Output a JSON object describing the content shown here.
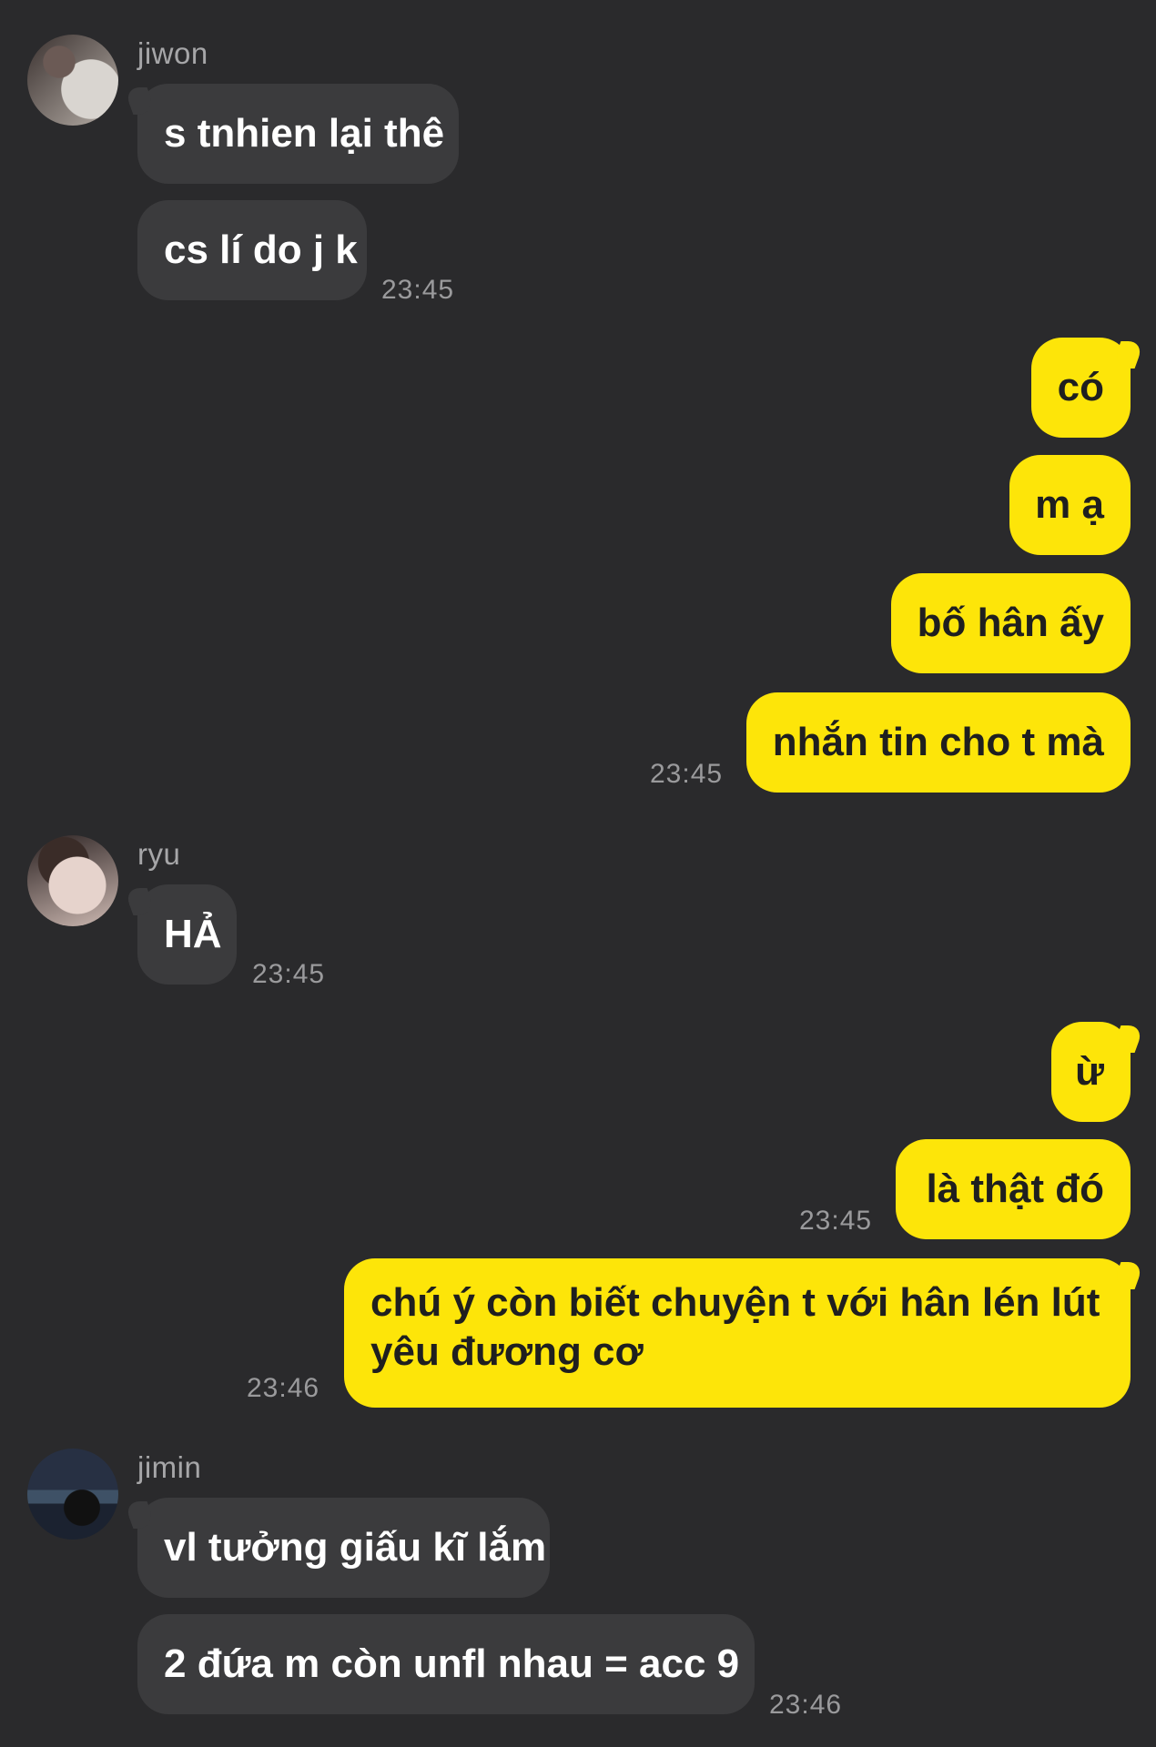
{
  "chat": {
    "groups": [
      {
        "sender": "jiwon",
        "avatar_icon": "profile-photo-jiwon",
        "messages": [
          "s tnhien lại thê",
          "cs lí do j k"
        ],
        "time": "23:45"
      },
      {
        "sender": "me",
        "messages": [
          "có",
          "m ạ",
          "bố hân ấy",
          "nhắn tin cho t mà"
        ],
        "time": "23:45"
      },
      {
        "sender": "ryu",
        "avatar_icon": "profile-photo-ryu",
        "messages": [
          "HẢ"
        ],
        "time": "23:45"
      },
      {
        "sender": "me",
        "messages": [
          "ừ",
          "là thật đó"
        ],
        "time": "23:45"
      },
      {
        "sender": "me",
        "messages": [
          "chú ý còn biết chuyện t với hân lén lút yêu đương cơ"
        ],
        "time": "23:46"
      },
      {
        "sender": "jimin",
        "avatar_icon": "profile-photo-jimin",
        "messages": [
          "vl tưởng giấu kĩ lắm",
          "2 đứa m còn unfl nhau = acc 9"
        ],
        "time": "23:46"
      }
    ]
  },
  "colors": {
    "background": "#2a2a2c",
    "incoming_bubble": "#3b3b3d",
    "outgoing_bubble": "#fde509",
    "timestamp": "#9a9a9c"
  }
}
